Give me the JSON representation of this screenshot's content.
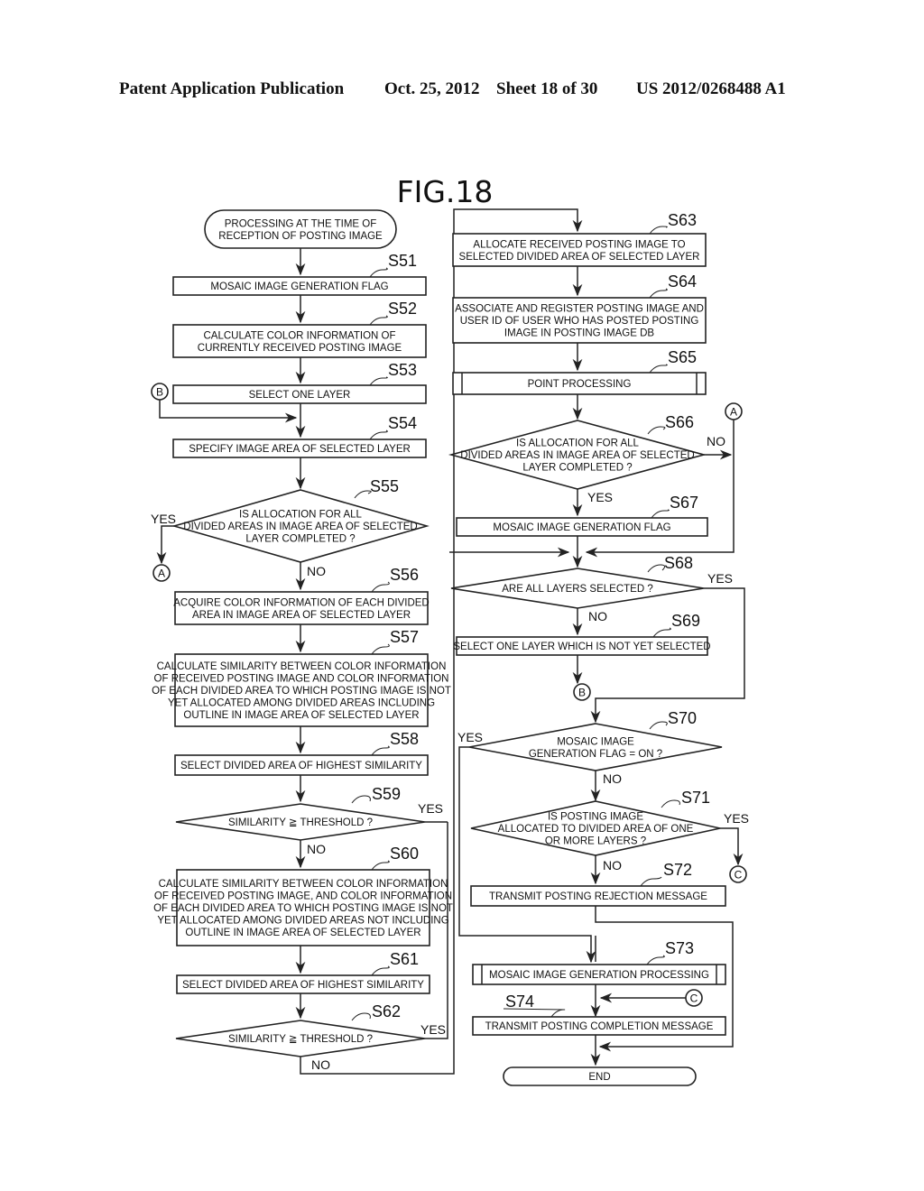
{
  "header": {
    "publication": "Patent Application Publication",
    "date": "Oct. 25, 2012",
    "sheet": "Sheet 18 of 30",
    "number": "US 2012/0268488 A1"
  },
  "figure": {
    "title": "FIG.18"
  },
  "nodes": {
    "start": {
      "lines": [
        "PROCESSING AT THE TIME OF",
        "RECEPTION OF POSTING IMAGE"
      ]
    },
    "s51": {
      "step": "S51",
      "lines": [
        "MOSAIC IMAGE GENERATION FLAG"
      ]
    },
    "s52": {
      "step": "S52",
      "lines": [
        "CALCULATE COLOR INFORMATION OF",
        "CURRENTLY RECEIVED POSTING IMAGE"
      ]
    },
    "s53": {
      "step": "S53",
      "lines": [
        "SELECT ONE LAYER"
      ]
    },
    "s54": {
      "step": "S54",
      "lines": [
        "SPECIFY IMAGE AREA OF SELECTED LAYER"
      ]
    },
    "s55": {
      "step": "S55",
      "lines": [
        "IS ALLOCATION FOR ALL",
        "DIVIDED AREAS IN IMAGE AREA OF SELECTED",
        "LAYER COMPLETED ?"
      ]
    },
    "s56": {
      "step": "S56",
      "lines": [
        "ACQUIRE COLOR INFORMATION OF EACH DIVIDED",
        "AREA IN IMAGE AREA OF SELECTED LAYER"
      ]
    },
    "s57": {
      "step": "S57",
      "lines": [
        "CALCULATE SIMILARITY BETWEEN COLOR INFORMATION",
        "OF RECEIVED POSTING IMAGE AND COLOR INFORMATION",
        "OF EACH DIVIDED AREA TO WHICH POSTING IMAGE IS NOT",
        "YET ALLOCATED AMONG DIVIDED AREAS INCLUDING",
        "OUTLINE IN IMAGE AREA OF SELECTED LAYER"
      ]
    },
    "s58": {
      "step": "S58",
      "lines": [
        "SELECT DIVIDED AREA OF HIGHEST SIMILARITY"
      ]
    },
    "s59": {
      "step": "S59",
      "lines": [
        "SIMILARITY ≧ THRESHOLD ?"
      ]
    },
    "s60": {
      "step": "S60",
      "lines": [
        "CALCULATE SIMILARITY BETWEEN COLOR INFORMATION",
        "OF RECEIVED POSTING IMAGE, AND COLOR INFORMATION",
        "OF EACH DIVIDED AREA TO WHICH POSTING IMAGE IS NOT",
        "YET ALLOCATED AMONG DIVIDED AREAS NOT INCLUDING",
        "OUTLINE IN IMAGE AREA OF SELECTED LAYER"
      ]
    },
    "s61": {
      "step": "S61",
      "lines": [
        "SELECT DIVIDED AREA OF HIGHEST SIMILARITY"
      ]
    },
    "s62": {
      "step": "S62",
      "lines": [
        "SIMILARITY ≧ THRESHOLD ?"
      ]
    },
    "s63": {
      "step": "S63",
      "lines": [
        "ALLOCATE RECEIVED POSTING IMAGE TO",
        "SELECTED DIVIDED AREA OF SELECTED LAYER"
      ]
    },
    "s64": {
      "step": "S64",
      "lines": [
        "ASSOCIATE AND REGISTER POSTING IMAGE AND",
        "USER ID OF USER WHO HAS POSTED POSTING",
        "IMAGE IN POSTING IMAGE DB"
      ]
    },
    "s65": {
      "step": "S65",
      "lines": [
        "POINT PROCESSING"
      ]
    },
    "s66": {
      "step": "S66",
      "lines": [
        "IS ALLOCATION FOR ALL",
        "DIVIDED AREAS IN IMAGE AREA OF SELECTED",
        "LAYER COMPLETED ?"
      ]
    },
    "s67": {
      "step": "S67",
      "lines": [
        "MOSAIC IMAGE GENERATION FLAG"
      ]
    },
    "s68": {
      "step": "S68",
      "lines": [
        "ARE ALL LAYERS SELECTED ?"
      ]
    },
    "s69": {
      "step": "S69",
      "lines": [
        "SELECT ONE LAYER WHICH IS NOT YET SELECTED"
      ]
    },
    "s70": {
      "step": "S70",
      "lines": [
        "MOSAIC IMAGE",
        "GENERATION FLAG = ON ?"
      ]
    },
    "s71": {
      "step": "S71",
      "lines": [
        "IS POSTING IMAGE",
        "ALLOCATED TO DIVIDED AREA OF ONE",
        "OR MORE LAYERS ?"
      ]
    },
    "s72": {
      "step": "S72",
      "lines": [
        "TRANSMIT POSTING REJECTION MESSAGE"
      ]
    },
    "s73": {
      "step": "S73",
      "lines": [
        "MOSAIC IMAGE GENERATION PROCESSING"
      ]
    },
    "s74": {
      "step": "S74",
      "lines": [
        "TRANSMIT POSTING COMPLETION MESSAGE"
      ]
    },
    "end": {
      "lines": [
        "END"
      ]
    }
  },
  "labels": {
    "yes": "YES",
    "no": "NO"
  },
  "connectors": {
    "a": "A",
    "b": "B",
    "c": "C"
  }
}
